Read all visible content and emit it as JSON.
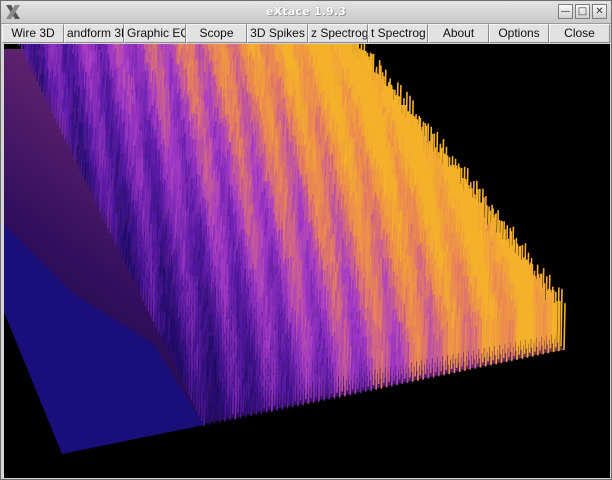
{
  "window": {
    "title": "eXtace 1.9.3",
    "app_icon": "x-logo-icon",
    "controls": {
      "minimize": "minimize-icon",
      "maximize": "maximize-icon",
      "close": "close-x-icon"
    }
  },
  "toolbar": {
    "buttons": [
      {
        "label": "Wire 3D"
      },
      {
        "label": "andform 3D"
      },
      {
        "label": "Graphic EQ"
      },
      {
        "label": "Scope"
      },
      {
        "label": "3D Spikes"
      },
      {
        "label": "z Spectrog"
      },
      {
        "label": "t Spectrog"
      },
      {
        "label": "About"
      },
      {
        "label": "Options"
      },
      {
        "label": "Close"
      }
    ]
  },
  "display": {
    "mode": "3D Spikes",
    "background_color": "#000000",
    "palette": [
      "#1a0a6e",
      "#5a1aa8",
      "#a83cc8",
      "#e8805a",
      "#f5b12a"
    ]
  }
}
